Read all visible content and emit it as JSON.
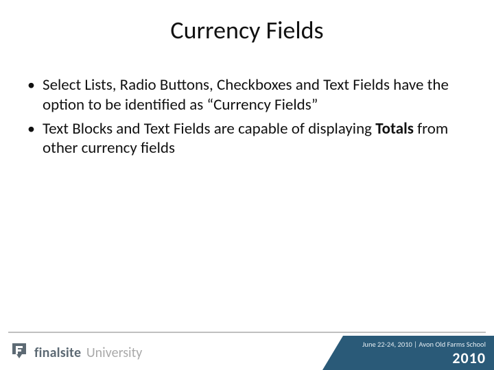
{
  "title": "Currency Fields",
  "bullets": [
    {
      "text_before": "Select Lists, Radio Buttons, Checkboxes and Text Fields have the option to be identified as “Currency Fields”",
      "bold": "",
      "text_after": ""
    },
    {
      "text_before": "Text Blocks and Text Fields are capable of displaying ",
      "bold": "Totals",
      "text_after": " from other currency fields"
    }
  ],
  "footer": {
    "brand_main": "finalsite",
    "brand_sub": "University",
    "event_line": "June 22-24, 2010 | Avon Old Farms School",
    "event_year": "2010"
  },
  "colors": {
    "footer_blue": "#2a5a78",
    "divider": "#bfbfbf",
    "brand_gray": "#5d6a74",
    "brand_light": "#a9a9a9"
  }
}
